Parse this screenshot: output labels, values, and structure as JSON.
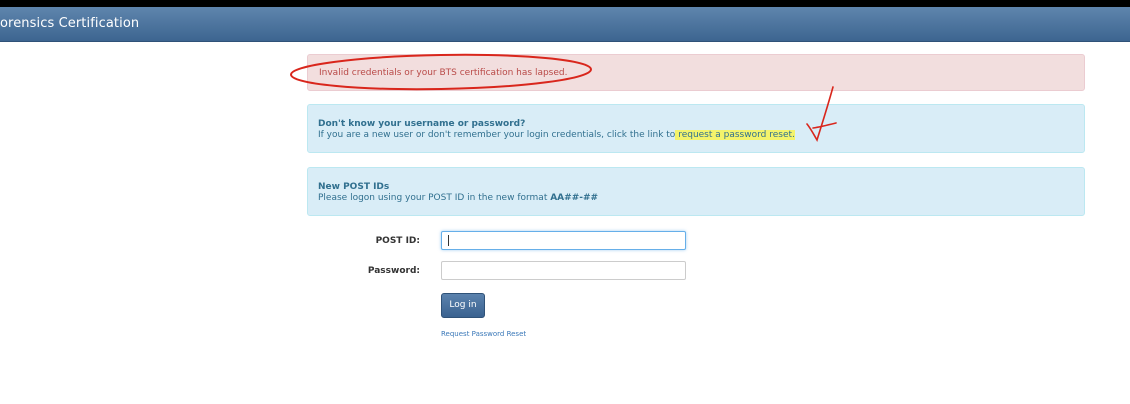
{
  "app": {
    "brand": "orensics Certification"
  },
  "alerts": {
    "error": {
      "message": "Invalid credentials or your BTS certification has lapsed."
    },
    "help": {
      "title": "Don't know your username or password?",
      "text_before": "If you are a new user or don't remember your login credentials, click the link to",
      "link": "request a password reset",
      "text_after": "."
    },
    "post_ids": {
      "title": "New POST IDs",
      "text": "Please logon using your POST ID in the new format",
      "format": "AA##-##"
    }
  },
  "form": {
    "post_id_label": "POST ID:",
    "post_id_value": "",
    "password_label": "Password:",
    "password_value": "",
    "login_button": "Log in",
    "reset_link": "Request Password Reset"
  },
  "colors": {
    "navbar": "#4a739c",
    "error_bg": "#f2dede",
    "error_text": "#b94a48",
    "info_bg": "#d9edf7",
    "info_text": "#31708f",
    "highlight": "#f3f36b",
    "annotation": "#d9261c"
  }
}
